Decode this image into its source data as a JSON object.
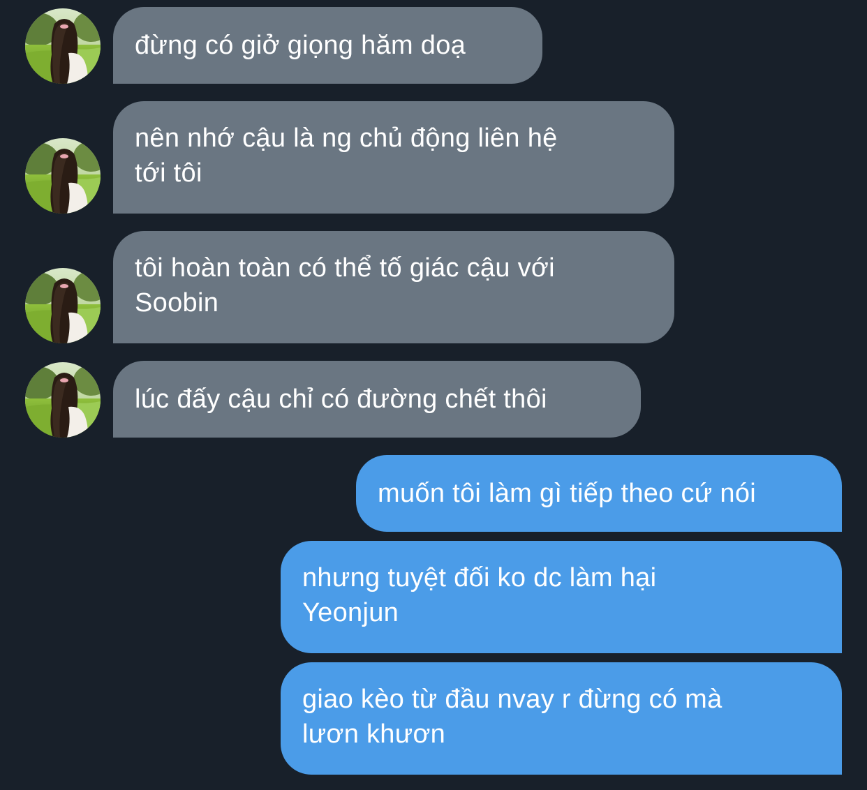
{
  "conversation": {
    "incoming": [
      {
        "lines": [
          "đừng có giở giọng hăm doạ"
        ]
      },
      {
        "lines": [
          "nên nhớ cậu là ng chủ động liên hệ",
          "tới tôi"
        ]
      },
      {
        "lines": [
          "tôi hoàn toàn có thể tố giác cậu với",
          "Soobin"
        ]
      },
      {
        "lines": [
          "lúc đấy cậu chỉ có đường chết thôi"
        ]
      }
    ],
    "outgoing": [
      {
        "lines": [
          "muốn tôi làm gì tiếp theo cứ nói"
        ]
      },
      {
        "lines": [
          "nhưng tuyệt đối ko dc làm hại",
          "Yeonjun"
        ]
      },
      {
        "lines": [
          "giao kèo từ đầu nvay r đừng có mà",
          "lươn khươn"
        ]
      }
    ]
  },
  "colors": {
    "background": "#18202a",
    "incoming_bubble": "#6a7682",
    "outgoing_bubble": "#4b9ce8",
    "text": "#ffffff"
  },
  "icons": {
    "avatar": "contact-photo-girl-in-park"
  }
}
